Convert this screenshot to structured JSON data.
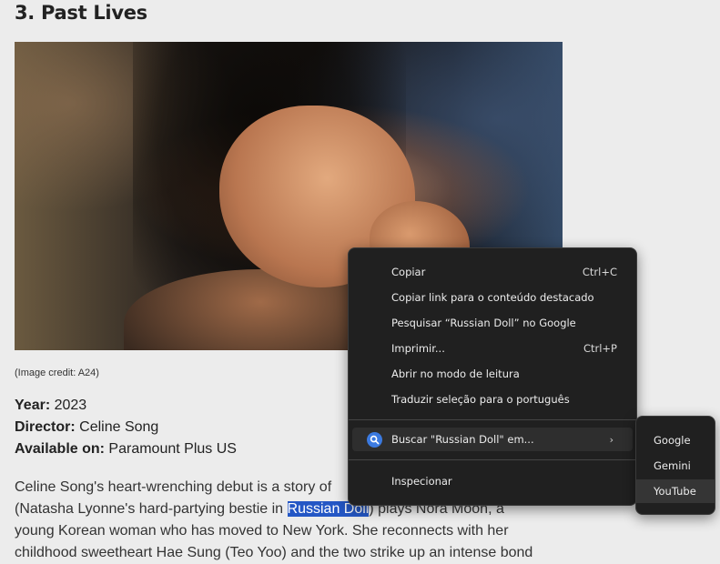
{
  "article": {
    "heading": "3. Past Lives",
    "image_credit": "(Image credit: A24)",
    "year_label": "Year:",
    "year_value": " 2023",
    "director_label": "Director:",
    "director_value": " Celine Song",
    "available_label": "Available on:",
    "available_value": " Paramount Plus US",
    "para_line1": "Celine Song's heart-wrenching debut is a story of",
    "para_line2_before": "(Natasha Lyonne's hard-partying bestie in ",
    "para_line2_selected": "Russian Doll",
    "para_line2_after": ") plays Nora Moon, a",
    "para_line3": "young Korean woman who has moved to New York. She reconnects with her",
    "para_line4": "childhood sweetheart Hae Sung (Teo Yoo) and the two strike up an intense bond"
  },
  "context_menu": {
    "items": [
      {
        "label": "Copiar",
        "shortcut": "Ctrl+C"
      },
      {
        "label": "Copiar link para o conteúdo destacado",
        "shortcut": ""
      },
      {
        "label": "Pesquisar “Russian Doll” no Google",
        "shortcut": ""
      },
      {
        "label": "Imprimir...",
        "shortcut": "Ctrl+P"
      },
      {
        "label": "Abrir no modo de leitura",
        "shortcut": ""
      },
      {
        "label": "Traduzir seleção para o português",
        "shortcut": ""
      }
    ],
    "search_in": {
      "label": "Buscar \"Russian Doll\" em...",
      "icon": "search-icon",
      "chevron": "›"
    },
    "inspect": {
      "label": "Inspecionar"
    }
  },
  "submenu": {
    "items": [
      "Google",
      "Gemini",
      "YouTube"
    ],
    "hovered": "YouTube"
  },
  "colors": {
    "selection": "#2457c5",
    "menu_bg": "#202020",
    "accent_icon": "#3b7ae0"
  }
}
